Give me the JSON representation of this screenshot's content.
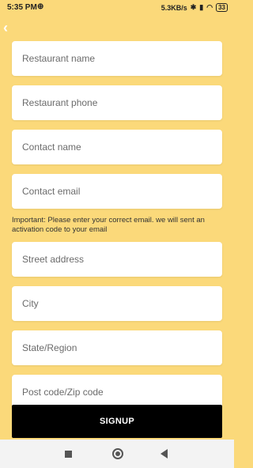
{
  "status_bar": {
    "time": "5:35 PM",
    "network_speed": "5.3KB/s",
    "battery": "33"
  },
  "form": {
    "fields": [
      {
        "placeholder": "Restaurant name"
      },
      {
        "placeholder": "Restaurant phone"
      },
      {
        "placeholder": "Contact name"
      },
      {
        "placeholder": "Contact email"
      },
      {
        "placeholder": "Street address"
      },
      {
        "placeholder": "City"
      },
      {
        "placeholder": "State/Region"
      },
      {
        "placeholder": "Post code/Zip code"
      }
    ],
    "email_note": "Important: Please enter your correct email. we will sent an activation code to your email",
    "signup_label": "SIGNUP"
  },
  "colors": {
    "background": "#fbd97a",
    "button": "#000000"
  }
}
